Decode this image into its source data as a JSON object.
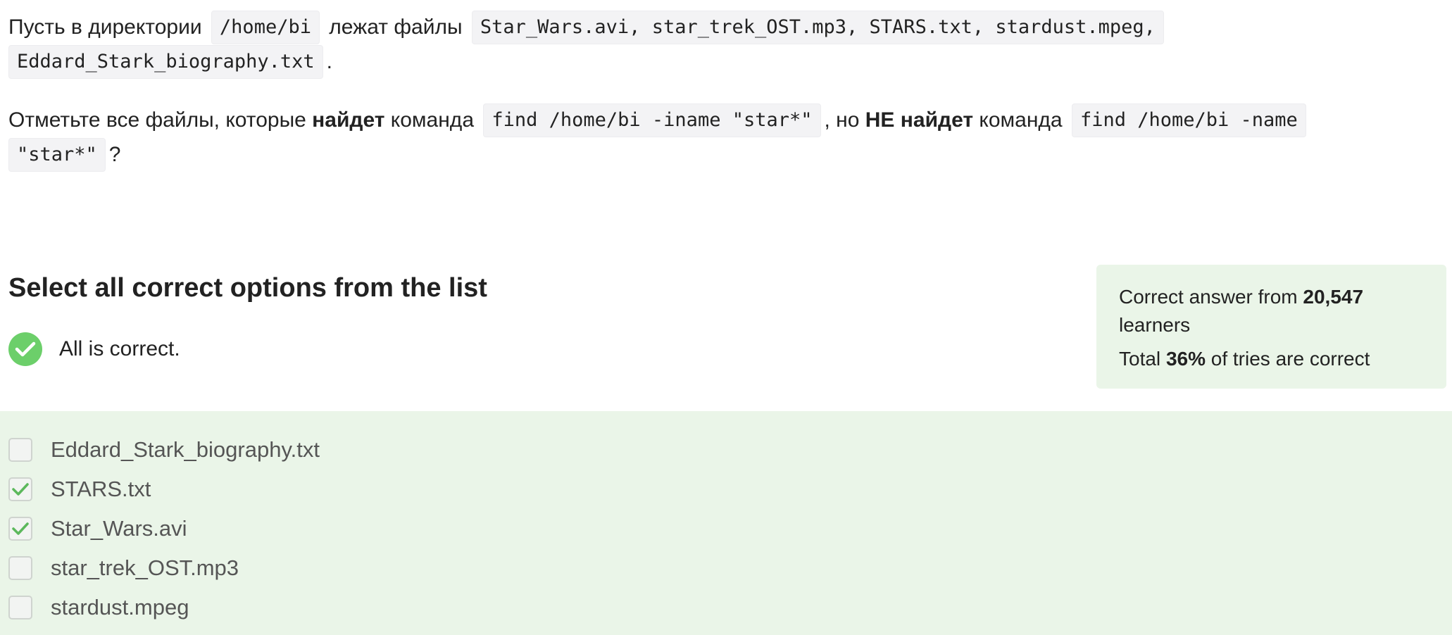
{
  "question": {
    "line1": {
      "t1": "Пусть в директории ",
      "c1": "/home/bi",
      "t2": " лежат файлы ",
      "c2": "Star_Wars.avi, star_trek_OST.mp3, STARS.txt, stardust.mpeg,"
    },
    "line2": {
      "c1": "Eddard_Stark_biography.txt",
      "t1": "."
    },
    "line3": {
      "t1": "Отметьте все файлы, которые ",
      "b1": "найдет",
      "t2": " команда ",
      "c1": "find /home/bi -iname \"star*\"",
      "t3": ", но ",
      "b2": "НЕ найдет",
      "t4": " команда ",
      "c2": "find /home/bi -name"
    },
    "line4": {
      "c1": "\"star*\"",
      "t1": "?"
    }
  },
  "section_title": "Select all correct options from the list",
  "status": {
    "text": "All is correct.",
    "icon": "check-circle-icon",
    "color": "#6ccf6a"
  },
  "stats": {
    "line1_prefix": "Correct answer from ",
    "learners_count": "20,547",
    "line1_suffix": "learners",
    "line2_prefix": "Total ",
    "percent": "36%",
    "line2_suffix": " of tries are correct"
  },
  "options": [
    {
      "label": "Eddard_Stark_biography.txt",
      "checked": false
    },
    {
      "label": "STARS.txt",
      "checked": true
    },
    {
      "label": "Star_Wars.avi",
      "checked": true
    },
    {
      "label": "star_trek_OST.mp3",
      "checked": false
    },
    {
      "label": "stardust.mpeg",
      "checked": false
    }
  ],
  "colors": {
    "accent_green": "#6ccf6a",
    "panel_green": "#eaf5e8",
    "check_green": "#5cb85c"
  }
}
